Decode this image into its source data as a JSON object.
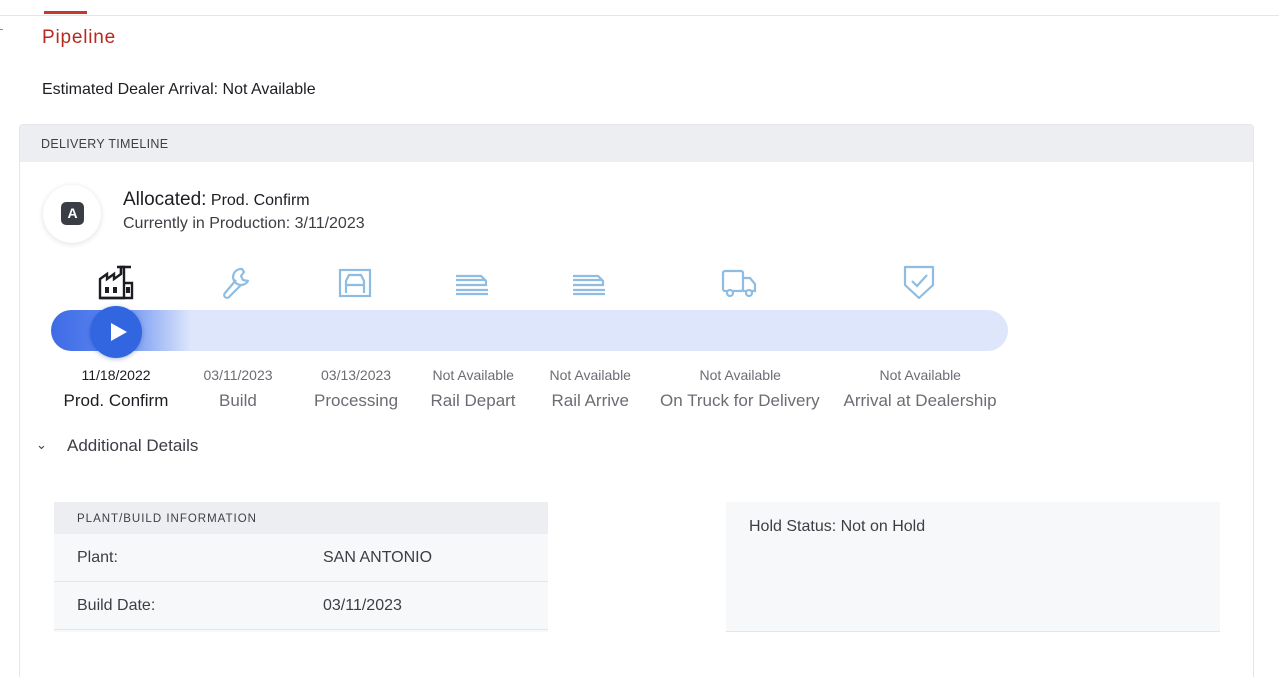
{
  "page": {
    "title": "Pipeline",
    "eta_text": "Estimated Dealer Arrival: Not Available"
  },
  "timeline": {
    "header": "DELIVERY TIMELINE",
    "badge_letter": "A",
    "status_key": "Allocated:",
    "status_value": " Prod. Confirm",
    "status_line2": "Currently in Production: 3/11/2023",
    "active_step_index": 0,
    "accent_color": "#3166e0",
    "steps": [
      {
        "icon": "factory-icon",
        "date": "11/18/2022",
        "label": "Prod. Confirm"
      },
      {
        "icon": "wrench-icon",
        "date": "03/11/2023",
        "label": "Build"
      },
      {
        "icon": "processing-icon",
        "date": "03/13/2023",
        "label": "Processing"
      },
      {
        "icon": "rail-car-icon",
        "date": "Not Available",
        "label": "Rail Depart"
      },
      {
        "icon": "rail-car-icon",
        "date": "Not Available",
        "label": "Rail Arrive"
      },
      {
        "icon": "truck-icon",
        "date": "Not Available",
        "label": "On Truck for Delivery"
      },
      {
        "icon": "shield-check-icon",
        "date": "Not Available",
        "label": "Arrival at Dealership"
      }
    ]
  },
  "details": {
    "toggle_label": "Additional Details",
    "plant": {
      "header": "PLANT/BUILD INFORMATION",
      "rows": [
        {
          "key": "Plant:",
          "value": "SAN ANTONIO"
        },
        {
          "key": "Build Date:",
          "value": "03/11/2023"
        }
      ]
    },
    "hold_status": "Hold Status: Not on Hold"
  }
}
